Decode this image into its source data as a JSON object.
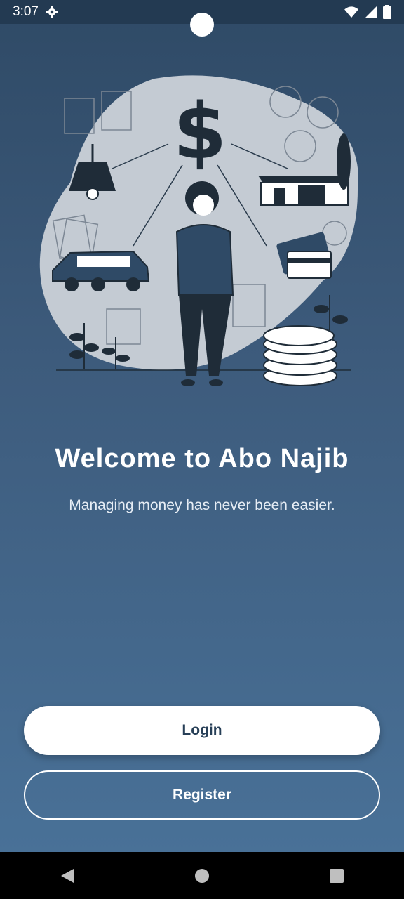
{
  "status_bar": {
    "time": "3:07",
    "icons": [
      "settings-icon",
      "wifi-icon",
      "signal-icon",
      "battery-icon"
    ]
  },
  "illustration": {
    "description_icons": [
      "dollar-sign-icon",
      "lamp-icon",
      "house-icon",
      "car-icon",
      "credit-card-icon",
      "coins-icon",
      "calendar-icon",
      "calculator-icon",
      "person-icon"
    ],
    "dollar_symbol": "$"
  },
  "welcome": {
    "title": "Welcome to Abo Najib",
    "subtitle": "Managing money has never been easier."
  },
  "buttons": {
    "login_label": "Login",
    "register_label": "Register"
  },
  "nav": {
    "icons": [
      "back-icon",
      "home-icon",
      "recents-icon"
    ]
  },
  "colors": {
    "primary": "#2f4a66",
    "accent": "#4a739a",
    "text_dark": "#273f57"
  }
}
